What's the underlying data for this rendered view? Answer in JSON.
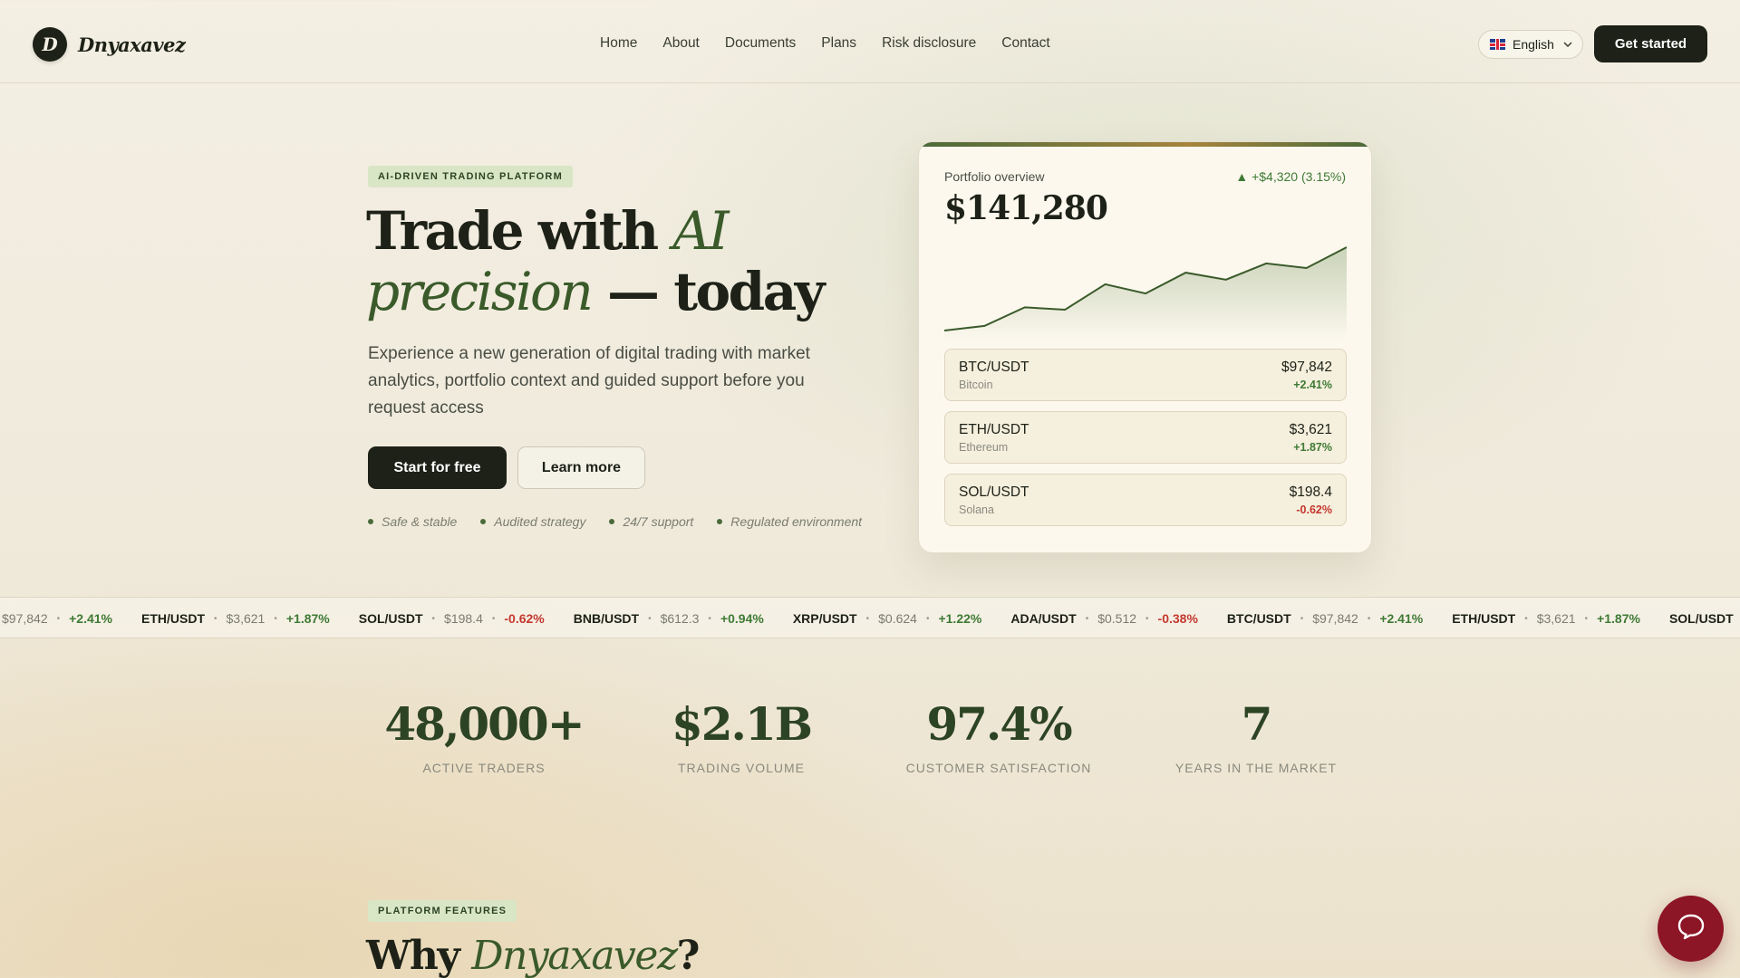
{
  "brand": {
    "logo_letter": "D",
    "name": "Dnyaxavez"
  },
  "nav": {
    "items": [
      "Home",
      "About",
      "Documents",
      "Plans",
      "Risk disclosure",
      "Contact"
    ],
    "language": "English",
    "cta": "Get started"
  },
  "hero": {
    "badge": "AI-DRIVEN TRADING PLATFORM",
    "title_a": "Trade with ",
    "title_b": "AI",
    "title_c": "precision",
    "title_d": " — today",
    "subtitle": "Experience a new generation of digital trading with market analytics, portfolio context and guided support before you request access",
    "primary_button": "Start for free",
    "secondary_button": "Learn more",
    "trust": [
      "Safe & stable",
      "Audited strategy",
      "24/7 support",
      "Regulated environment"
    ]
  },
  "portfolio": {
    "label": "Portfolio overview",
    "change": "▲ +$4,320 (3.15%)",
    "value": "$141,280",
    "sparkline": [
      20,
      22,
      30,
      29,
      40,
      36,
      45,
      42,
      49,
      47,
      56
    ],
    "assets": [
      {
        "pair": "BTC/USDT",
        "name": "Bitcoin",
        "price": "$97,842",
        "change": "+2.41%",
        "direction": "up"
      },
      {
        "pair": "ETH/USDT",
        "name": "Ethereum",
        "price": "$3,621",
        "change": "+1.87%",
        "direction": "up"
      },
      {
        "pair": "SOL/USDT",
        "name": "Solana",
        "price": "$198.4",
        "change": "-0.62%",
        "direction": "down"
      }
    ]
  },
  "ticker": [
    {
      "sym": "",
      "price": "$97,842",
      "change": "+2.41%",
      "direction": "up"
    },
    {
      "sym": "ETH/USDT",
      "price": "$3,621",
      "change": "+1.87%",
      "direction": "up"
    },
    {
      "sym": "SOL/USDT",
      "price": "$198.4",
      "change": "-0.62%",
      "direction": "down"
    },
    {
      "sym": "BNB/USDT",
      "price": "$612.3",
      "change": "+0.94%",
      "direction": "up"
    },
    {
      "sym": "XRP/USDT",
      "price": "$0.624",
      "change": "+1.22%",
      "direction": "up"
    },
    {
      "sym": "ADA/USDT",
      "price": "$0.512",
      "change": "-0.38%",
      "direction": "down"
    },
    {
      "sym": "BTC/USDT",
      "price": "$97,842",
      "change": "+2.41%",
      "direction": "up"
    },
    {
      "sym": "ETH/USDT",
      "price": "$3,621",
      "change": "+1.87%",
      "direction": "up"
    },
    {
      "sym": "SOL/USDT",
      "price": "",
      "change": "",
      "direction": "down"
    }
  ],
  "stats": [
    {
      "value": "48,000+",
      "label": "ACTIVE TRADERS"
    },
    {
      "value": "$2.1B",
      "label": "TRADING VOLUME"
    },
    {
      "value": "97.4%",
      "label": "CUSTOMER SATISFACTION"
    },
    {
      "value": "7",
      "label": "YEARS IN THE MARKET"
    }
  ],
  "features": {
    "badge": "PLATFORM FEATURES",
    "title_a": "Why ",
    "title_b": "Dnyaxavez",
    "title_c": "?"
  },
  "colors": {
    "accent": "#3a5a2a",
    "dark": "#1d2117",
    "up": "#3e7a34",
    "down": "#c4382f",
    "chat": "#8c1526"
  },
  "icons": {
    "chat": "chat-bubble-icon",
    "chevron": "chevron-down-icon",
    "flag": "uk-flag-icon"
  }
}
